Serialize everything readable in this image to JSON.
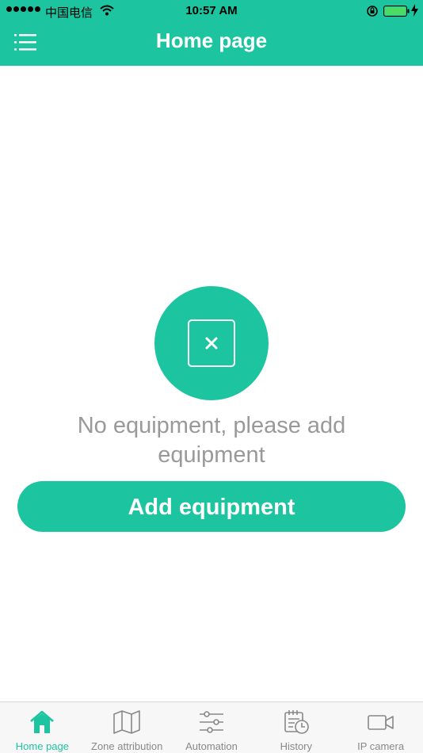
{
  "status_bar": {
    "carrier": "中国电信",
    "time": "10:57 AM"
  },
  "header": {
    "title": "Home page"
  },
  "empty_state": {
    "message": "No equipment, please add equipment",
    "add_button": "Add equipment"
  },
  "tabs": [
    {
      "label": "Home page",
      "icon": "home-icon",
      "active": true
    },
    {
      "label": "Zone attribution",
      "icon": "map-icon",
      "active": false
    },
    {
      "label": "Automation",
      "icon": "sliders-icon",
      "active": false
    },
    {
      "label": "History",
      "icon": "calendar-clock-icon",
      "active": false
    },
    {
      "label": "IP camera",
      "icon": "video-camera-icon",
      "active": false
    }
  ],
  "colors": {
    "accent": "#1cc4a0",
    "muted_text": "#999999",
    "tab_inactive": "#888888"
  }
}
